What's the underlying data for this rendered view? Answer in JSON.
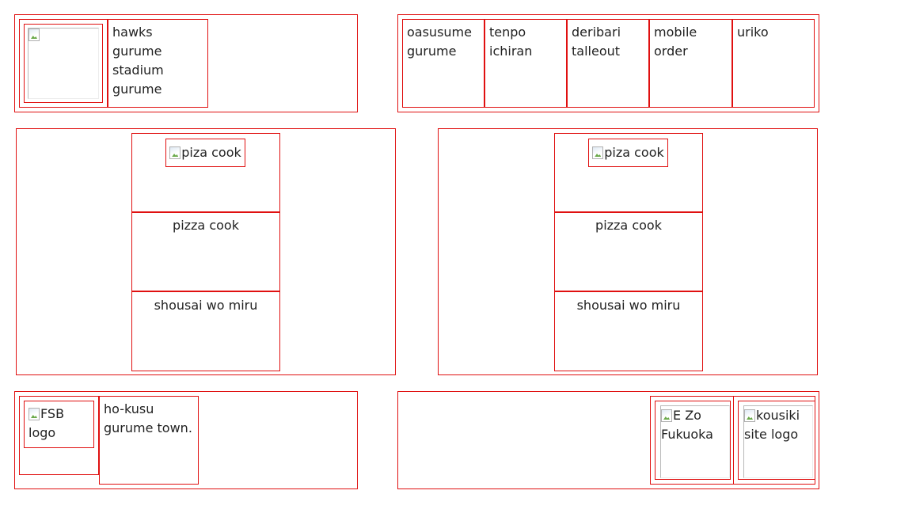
{
  "header_left": {
    "logo_alt": "",
    "title": "hawks gurume stadium gurume"
  },
  "nav": {
    "items": [
      {
        "label": "oasusume gurume"
      },
      {
        "label": "tenpo ichiran"
      },
      {
        "label": "deribari talleout"
      },
      {
        "label": "mobile order"
      },
      {
        "label": "uriko"
      }
    ]
  },
  "cards": [
    {
      "image_alt": "piza cook",
      "name": "pizza cook",
      "detail_link": "shousai wo miru"
    },
    {
      "image_alt": "piza cook",
      "name": "pizza cook",
      "detail_link": "shousai wo miru"
    }
  ],
  "footer_left": {
    "logo_alt": "FSB logo",
    "text": "ho-kusu gurume town."
  },
  "footer_right": {
    "logos": [
      {
        "alt": "E Zo Fukuoka"
      },
      {
        "alt": "kousiki site logo"
      }
    ]
  },
  "colors": {
    "border": "#e01010",
    "text": "#222222",
    "background": "#ffffff"
  },
  "icons": [
    "broken-image-icon"
  ]
}
